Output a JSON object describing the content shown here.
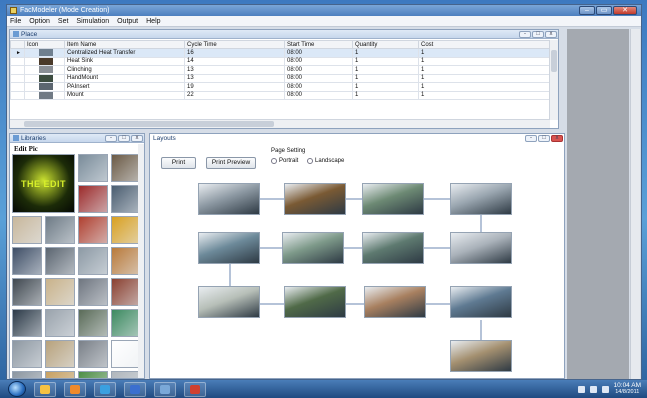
{
  "window": {
    "title": "FacModeler (Mode Creation)"
  },
  "menu": [
    "File",
    "Option",
    "Set",
    "Simulation",
    "Output",
    "Help"
  ],
  "place_panel": {
    "title": "Place",
    "columns": [
      "Icon",
      "Item Name",
      "Cycle Time",
      "Start Time",
      "Quantity",
      "Cost"
    ],
    "rows": [
      {
        "selected": true,
        "item_name": "Centralized Heat Transfer",
        "cycle_time": "16",
        "start_time": "08:00",
        "quantity": "1",
        "cost": "1",
        "icon_color": "#6f7f8f"
      },
      {
        "selected": false,
        "item_name": "Heat Sink",
        "cycle_time": "14",
        "start_time": "08:00",
        "quantity": "1",
        "cost": "1",
        "icon_color": "#4a3a2a"
      },
      {
        "selected": false,
        "item_name": "Clinching",
        "cycle_time": "13",
        "start_time": "08:00",
        "quantity": "1",
        "cost": "1",
        "icon_color": "#8a8f96"
      },
      {
        "selected": false,
        "item_name": "HandMount",
        "cycle_time": "13",
        "start_time": "08:00",
        "quantity": "1",
        "cost": "1",
        "icon_color": "#3d4d40"
      },
      {
        "selected": false,
        "item_name": "PAInsert",
        "cycle_time": "19",
        "start_time": "08:00",
        "quantity": "1",
        "cost": "1",
        "icon_color": "#5c6670"
      },
      {
        "selected": false,
        "item_name": "Mount",
        "cycle_time": "22",
        "start_time": "08:00",
        "quantity": "1",
        "cost": "1",
        "icon_color": "#707a85"
      }
    ],
    "row_marker": "►"
  },
  "libraries_panel": {
    "title": "Libraries",
    "edit_label": "Edit Pic",
    "featured_text": "THE EDIT",
    "tiles": [
      "#7a8c9a",
      "#6b5a45",
      "#9c2b2b",
      "#4a5d70",
      "#c8b79b",
      "#6e7b86",
      "#b04030",
      "#d9a020",
      "#3e4e66",
      "#5b6570",
      "#8d9aa5",
      "#b97a3a",
      "#404850",
      "#c9b28a",
      "#6f7680",
      "#8a4030",
      "#2c3a48",
      "#9aa3ac",
      "#5a6b58",
      "#3c8a60",
      "#8e98a2",
      "#b8a27c",
      "#7a8088",
      "#ffffff",
      "#8c96a0",
      "#c8a060",
      "#4e8f45",
      "#b0b6bc"
    ]
  },
  "layouts_panel": {
    "title": "Layouts",
    "print_label": "Print",
    "print_preview_label": "Print Preview",
    "page_setting_label": "Page Setting",
    "portrait_label": "Portrait",
    "landscape_label": "Landscape",
    "stations": [
      {
        "id": "s1",
        "color": "#8e9aa4"
      },
      {
        "id": "s2",
        "color": "#7a5a34"
      },
      {
        "id": "s3",
        "color": "#6d8a74"
      },
      {
        "id": "s4",
        "color": "#9aa6b0"
      },
      {
        "id": "s5",
        "color": "#6d8a9a"
      },
      {
        "id": "s6",
        "color": "#7e9a8a"
      },
      {
        "id": "s7",
        "color": "#5e7a70"
      },
      {
        "id": "s8",
        "color": "#aab2ba"
      },
      {
        "id": "s9",
        "color": "#b7bfb8"
      },
      {
        "id": "s10",
        "color": "#506a48"
      },
      {
        "id": "s11",
        "color": "#a88060"
      },
      {
        "id": "s12",
        "color": "#5f7a92"
      },
      {
        "id": "s13",
        "color": "#a49070"
      }
    ]
  },
  "taskbar": {
    "time": "10:04 AM",
    "date": "14/8/2011",
    "apps": [
      "#f5c242",
      "#f08a2c",
      "#3aa0e0",
      "#3b6fcf",
      "#7aa8d8",
      "#d04030"
    ]
  }
}
